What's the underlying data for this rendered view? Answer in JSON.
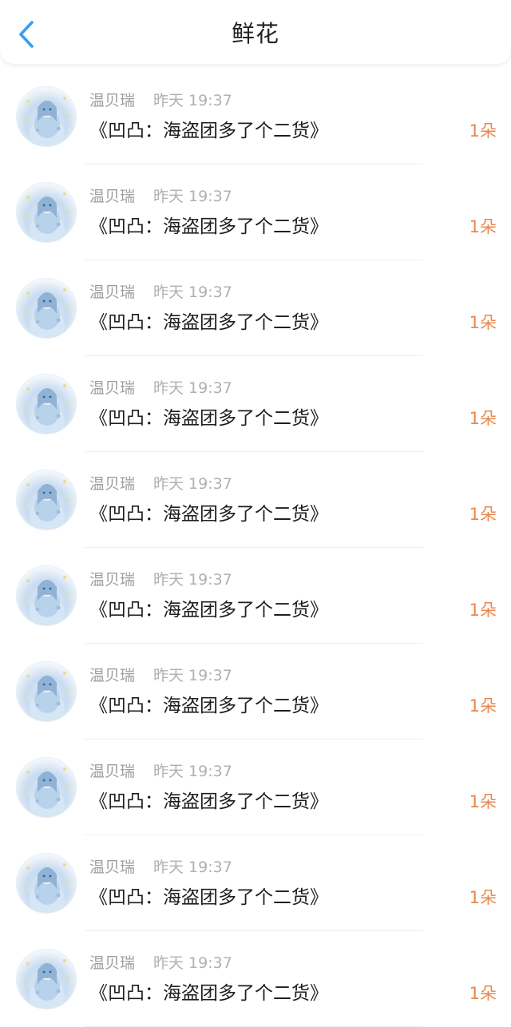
{
  "header": {
    "title": "鲜花",
    "back_icon": "chevron-left-icon",
    "accent_color": "#3a9df5"
  },
  "items": [
    {
      "sender": "温贝瑞",
      "time": "昨天 19:37",
      "message": "《凹凸：海盗团多了个二货》",
      "count": "1朵"
    },
    {
      "sender": "温贝瑞",
      "time": "昨天 19:37",
      "message": "《凹凸：海盗团多了个二货》",
      "count": "1朵"
    },
    {
      "sender": "温贝瑞",
      "time": "昨天 19:37",
      "message": "《凹凸：海盗团多了个二货》",
      "count": "1朵"
    },
    {
      "sender": "温贝瑞",
      "time": "昨天 19:37",
      "message": "《凹凸：海盗团多了个二货》",
      "count": "1朵"
    },
    {
      "sender": "温贝瑞",
      "time": "昨天 19:37",
      "message": "《凹凸：海盗团多了个二货》",
      "count": "1朵"
    },
    {
      "sender": "温贝瑞",
      "time": "昨天 19:37",
      "message": "《凹凸：海盗团多了个二货》",
      "count": "1朵"
    },
    {
      "sender": "温贝瑞",
      "time": "昨天 19:37",
      "message": "《凹凸：海盗团多了个二货》",
      "count": "1朵"
    },
    {
      "sender": "温贝瑞",
      "time": "昨天 19:37",
      "message": "《凹凸：海盗团多了个二货》",
      "count": "1朵"
    },
    {
      "sender": "温贝瑞",
      "time": "昨天 19:37",
      "message": "《凹凸：海盗团多了个二货》",
      "count": "1朵"
    },
    {
      "sender": "温贝瑞",
      "time": "昨天 19:37",
      "message": "《凹凸：海盗团多了个二货》",
      "count": "1朵"
    }
  ],
  "colors": {
    "count_text": "#e8884e",
    "sender_text": "#9e9e9e",
    "message_text": "#1f1f1f"
  }
}
